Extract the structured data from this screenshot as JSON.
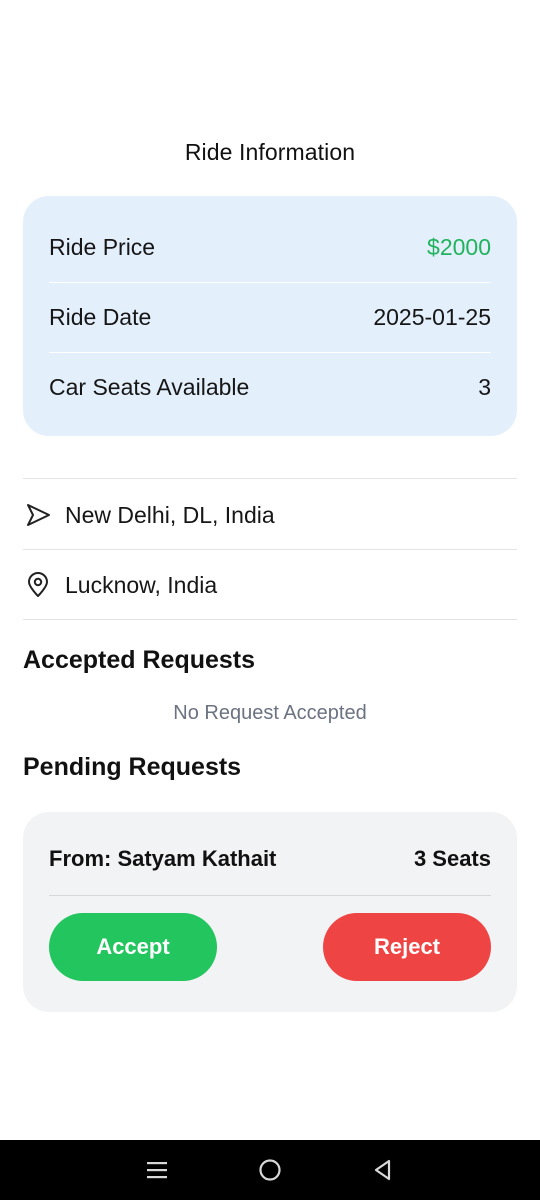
{
  "header": {
    "title": "Ride Information"
  },
  "ride_info": {
    "rows": [
      {
        "label": "Ride Price",
        "value": "$2000"
      },
      {
        "label": "Ride Date",
        "value": "2025-01-25"
      },
      {
        "label": "Car Seats Available",
        "value": "3"
      }
    ]
  },
  "route": {
    "origin": {
      "icon": "navigation-arrow-icon",
      "text": "New Delhi, DL, India"
    },
    "destination": {
      "icon": "map-pin-icon",
      "text": "Lucknow, India"
    }
  },
  "accepted_requests": {
    "heading": "Accepted Requests",
    "empty_message": "No Request Accepted"
  },
  "pending_requests": {
    "heading": "Pending Requests",
    "items": [
      {
        "from": "From: Satyam Kathait",
        "seats": "3 Seats",
        "accept_label": "Accept",
        "reject_label": "Reject"
      }
    ]
  },
  "system_nav": {
    "buttons": [
      "menu-icon",
      "home-circle-icon",
      "back-triangle-icon"
    ]
  },
  "colors": {
    "price": "#22b35e",
    "info_card_bg": "#e3effb",
    "accept": "#22c55e",
    "reject": "#ef4444",
    "muted_text": "#6b7280"
  }
}
